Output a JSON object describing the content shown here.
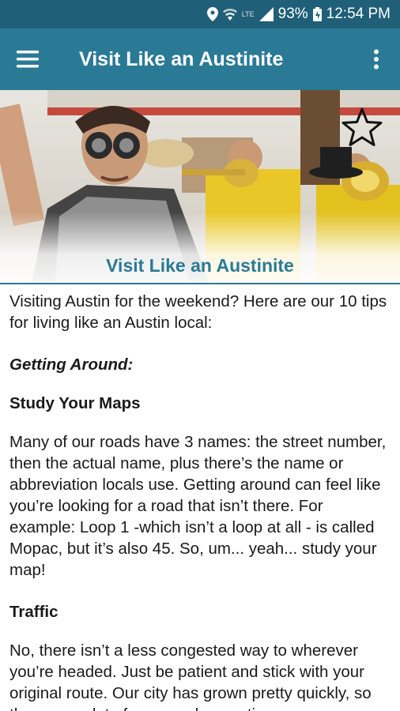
{
  "status_bar": {
    "battery_percent": "93%",
    "time": "12:54 PM",
    "network_label": "LTE"
  },
  "app_bar": {
    "title": "Visit Like an Austinite"
  },
  "hero": {
    "caption": "Visit Like an Austinite"
  },
  "article": {
    "intro": "Visiting Austin for the weekend? Here are our 10 tips for living like an Austin local:",
    "category": "Getting Around:",
    "sections": [
      {
        "heading": "Study Your Maps",
        "body": "Many of our roads have 3 names: the street number, then the actual name, plus there’s the name or abbreviation locals use. Getting around can feel like you’re looking for a road that isn’t there. For example: Loop 1 -which isn’t a loop at all - is called Mopac, but it’s also 45. So, um... yeah... study your map!"
      },
      {
        "heading": "Traffic",
        "body": "No, there isn’t a less congested way to wherever you’re headed. Just be patient and stick with your original route. Our city has grown pretty quickly, so there are a lot of cars, and every time"
      }
    ]
  },
  "icons": {
    "menu": "hamburger-menu-icon",
    "more": "overflow-menu-icon",
    "favorite": "star-outline-icon",
    "location": "location-pin-icon",
    "wifi": "wifi-icon",
    "signal": "cell-signal-icon",
    "battery": "battery-icon"
  },
  "colors": {
    "status_bar": "#1f5f78",
    "app_bar": "#2a7a96",
    "caption": "#2a7a96"
  }
}
